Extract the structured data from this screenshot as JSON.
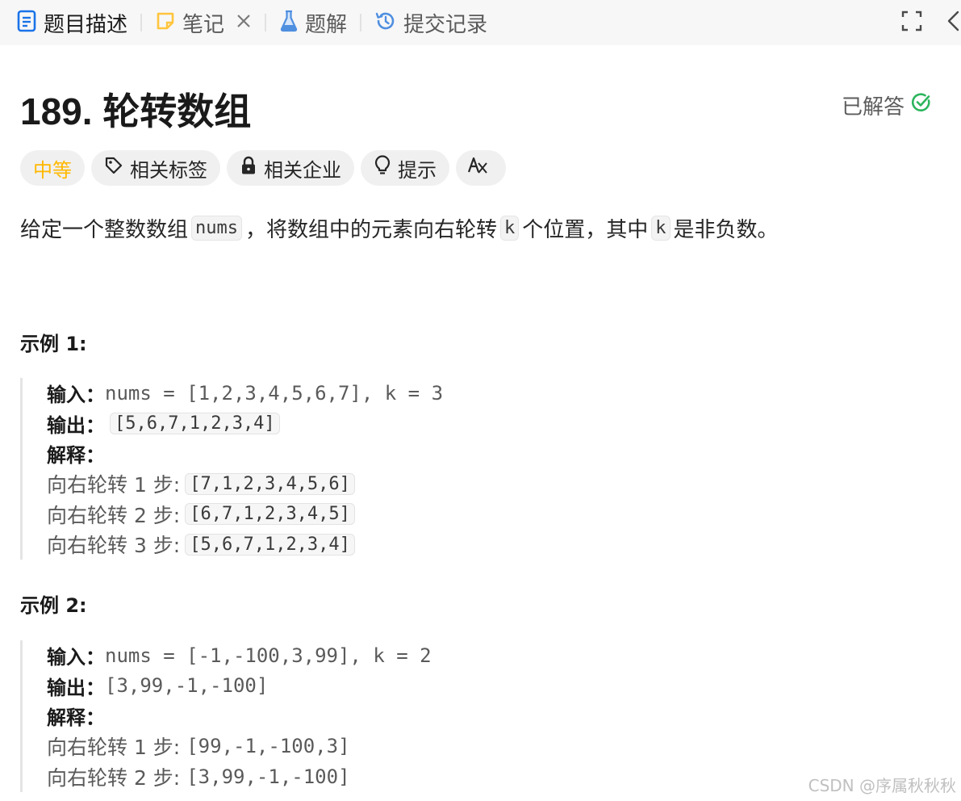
{
  "tabs": [
    {
      "label": "题目描述"
    },
    {
      "label": "笔记"
    },
    {
      "label": "题解"
    },
    {
      "label": "提交记录"
    }
  ],
  "problem": {
    "title": "189. 轮转数组",
    "status": "已解答",
    "tags": {
      "difficulty": "中等",
      "related_tags": "相关标签",
      "related_companies": "相关企业",
      "hint": "提示"
    },
    "description": {
      "part1": "给定一个整数数组",
      "code1": "nums",
      "part2": "，将数组中的元素向右轮转",
      "code2": "k",
      "part3": "个位置，其中",
      "code3": "k",
      "part4": "是非负数。"
    }
  },
  "examples": [
    {
      "title": "示例 1:",
      "input_label": "输入：",
      "input": "nums = [1,2,3,4,5,6,7], k = 3",
      "output_label": "输出：",
      "output": "[5,6,7,1,2,3,4]",
      "explain_label": "解释：",
      "steps": [
        {
          "text": "向右轮转 1 步:",
          "result": "[7,1,2,3,4,5,6]"
        },
        {
          "text": "向右轮转 2 步:",
          "result": "[6,7,1,2,3,4,5]"
        },
        {
          "text": "向右轮转 3 步:",
          "result": "[5,6,7,1,2,3,4]"
        }
      ]
    },
    {
      "title": "示例 2:",
      "input_label": "输入：",
      "input": "nums = [-1,-100,3,99], k = 2",
      "output_label": "输出：",
      "output": "[3,99,-1,-100]",
      "explain_label": "解释：",
      "steps": [
        {
          "text": "向右轮转 1 步:",
          "result": "[99,-1,-100,3]"
        },
        {
          "text": "向右轮转 2 步:",
          "result": "[3,99,-1,-100]"
        }
      ]
    }
  ],
  "watermark": "CSDN @序属秋秋秋",
  "colors": {
    "accent_blue": "#1a73e8",
    "difficulty_medium": "#ffb800",
    "solved_green": "#2db55d",
    "note_yellow": "#ffc53d"
  },
  "icons": [
    "description-icon",
    "note-icon",
    "close-icon",
    "flask-icon",
    "history-icon",
    "fullscreen-icon",
    "collapse-icon",
    "check-circle-icon",
    "tag-icon",
    "lock-icon",
    "lightbulb-icon",
    "translate-icon"
  ]
}
